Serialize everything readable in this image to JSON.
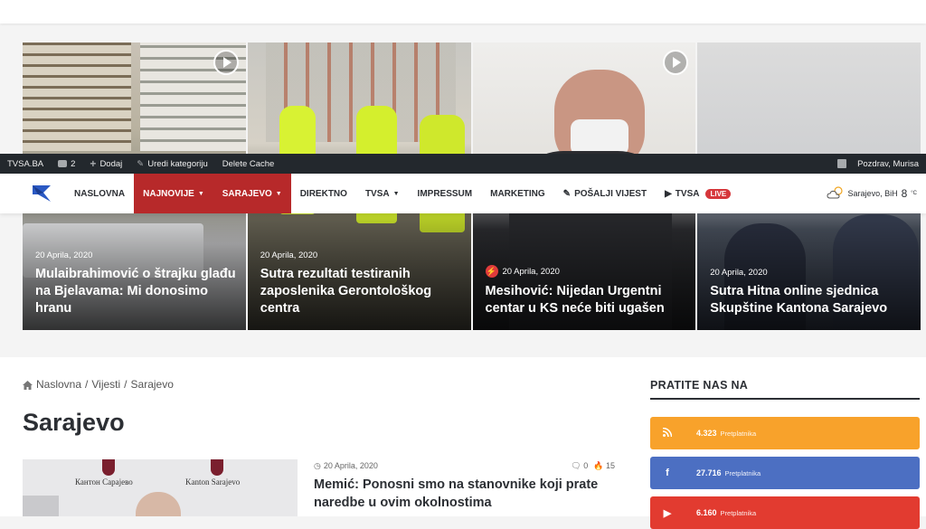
{
  "colors": {
    "accent": "#b7292a",
    "admin_bar": "#23282d",
    "rss": "#f8a22b",
    "facebook": "#4c6fc2",
    "youtube": "#e23b30"
  },
  "admin_bar": {
    "site": "TVSA.BA",
    "comments_count": "2",
    "add": "Dodaj",
    "edit_category": "Uredi kategoriju",
    "delete_cache": "Delete Cache",
    "greeting": "Pozdrav, Murisa"
  },
  "nav": {
    "items": [
      "Naslovna",
      "Najnovije",
      "Sarajevo",
      "Direktno",
      "TVSA",
      "Impressum",
      "Marketing",
      "Pošalji vijest",
      "TVSA"
    ],
    "live_badge": "LIVE",
    "weather_location": "Sarajevo, BiH",
    "weather_temp": "8",
    "weather_unit": "°C"
  },
  "slider": [
    {
      "date": "20 Aprila, 2020",
      "title": "Mulaibrahimović o štrajku glađu na Bjelavama: Mi donosimo hranu",
      "video": true
    },
    {
      "date": "20 Aprila, 2020",
      "title": "Sutra rezultati testiranih zaposlenika Gerontološkog centra",
      "video": false
    },
    {
      "date": "20 Aprila, 2020",
      "title": "Mesihović: Nijedan Urgentni centar u KS neće biti ugašen",
      "video": true,
      "flash": true
    },
    {
      "date": "20 Aprila, 2020",
      "title": "Sutra Hitna online sjednica Skupštine Kantona Sarajevo",
      "video": false
    }
  ],
  "breadcrumb": {
    "home": "Naslovna",
    "sep": "/",
    "section": "Vijesti",
    "current": "Sarajevo"
  },
  "page_title": "Sarajevo",
  "post": {
    "date": "20 Aprila, 2020",
    "comments": "0",
    "views": "15",
    "title": "Memić: Ponosni smo na stanovnike koji prate naredbe u ovim okolnostima",
    "thumb_text_left": "Кантон Сарајево",
    "thumb_text_right": "Kanton Sarajevo"
  },
  "widget": {
    "title": "PRATITE NAS NA",
    "socials": [
      {
        "icon": "rss-icon",
        "count": "4.323",
        "label": "Pretplatnika"
      },
      {
        "icon": "facebook-icon",
        "count": "27.716",
        "label": "Pretplatnika"
      },
      {
        "icon": "youtube-icon",
        "count": "6.160",
        "label": "Pretplatnika"
      }
    ]
  }
}
